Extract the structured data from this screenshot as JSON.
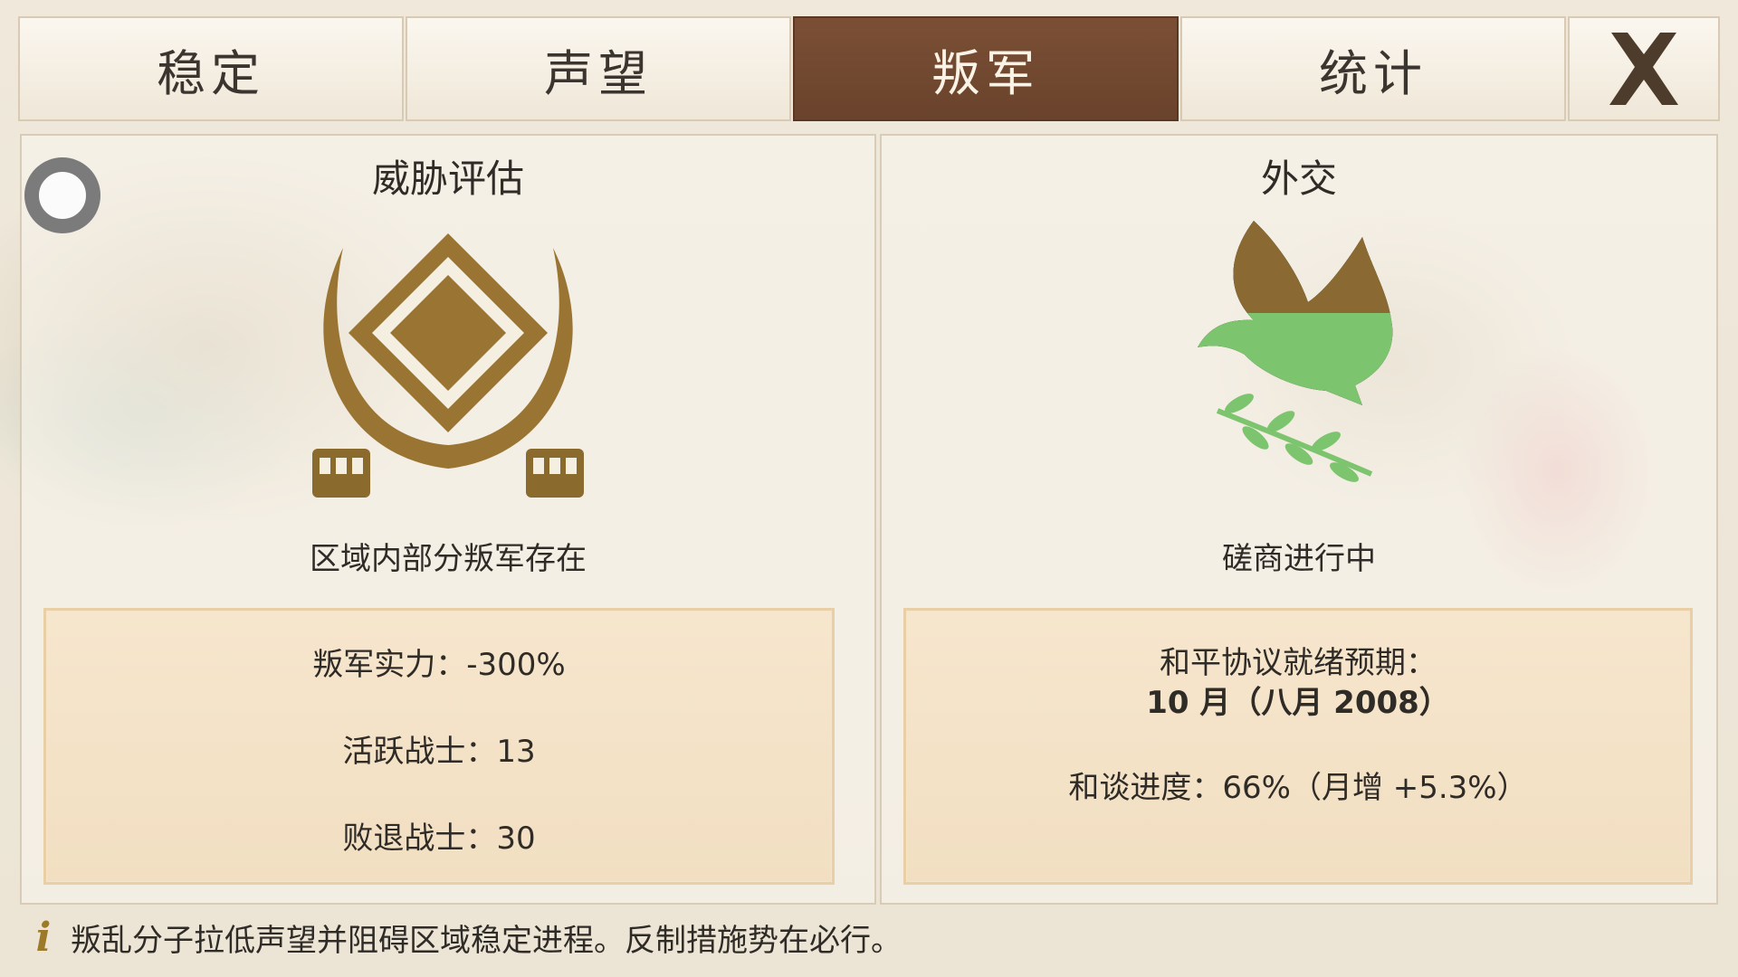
{
  "tabs": [
    {
      "label": "稳定",
      "active": false
    },
    {
      "label": "声望",
      "active": false
    },
    {
      "label": "叛军",
      "active": true
    },
    {
      "label": "统计",
      "active": false
    }
  ],
  "colors": {
    "active_tab": "#6e462f",
    "accent_gold": "#9a7433",
    "dove_green": "#7dc46f",
    "stat_box": "#f4e2c7"
  },
  "threat": {
    "title": "威胁评估",
    "icon": "rebel-emblem-icon",
    "status": "区域内部分叛军存在",
    "stats": [
      "叛军实力：-300%",
      "活跃战士：13",
      "败退战士：30"
    ]
  },
  "diplomacy": {
    "title": "外交",
    "icon": "peace-dove-icon",
    "status": "磋商进行中",
    "peace_label": "和平协议就绪预期：",
    "peace_date": "10 月（八月 2008）",
    "progress": "和谈进度：66%（月增 +5.3%）"
  },
  "footer": {
    "icon": "info-icon",
    "text": "叛乱分子拉低声望并阻碍区域稳定进程。反制措施势在必行。"
  }
}
